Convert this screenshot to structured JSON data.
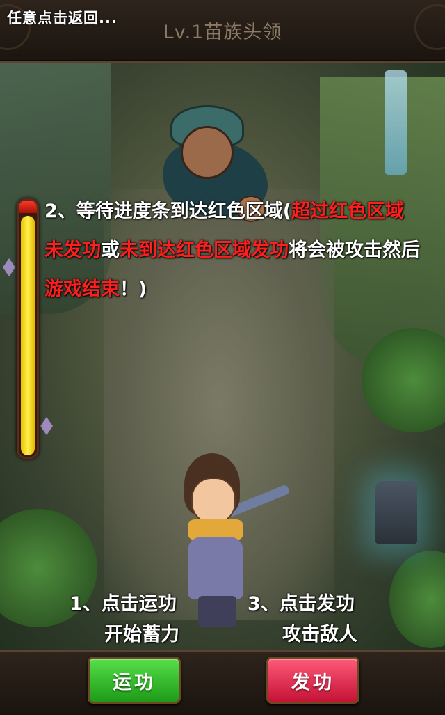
{
  "header": {
    "back_hint": "任意点击返回...",
    "level_title": "Lv.1苗族头领"
  },
  "instruction": {
    "parts": [
      {
        "text": "2、等待进度条到达红色区域(",
        "color": "white"
      },
      {
        "text": "超过红色区域未发功",
        "color": "red"
      },
      {
        "text": "或",
        "color": "white"
      },
      {
        "text": "未到达红色区域发功",
        "color": "red"
      },
      {
        "text": "将会被攻击然后",
        "color": "white"
      },
      {
        "text": "游戏结束",
        "color": "red"
      },
      {
        "text": "！)",
        "color": "white"
      }
    ]
  },
  "steps": {
    "step1": {
      "line1": "1、点击运功",
      "line2": "开始蓄力"
    },
    "step3": {
      "line1": "3、点击发功",
      "line2": "攻击敌人"
    }
  },
  "gauge": {
    "fill_fraction": 0.95,
    "fill_color": "#f2d600",
    "red_zone_color": "#e02010"
  },
  "buttons": {
    "charge_label": "运功",
    "release_label": "发功",
    "charge_color": "#2fbf28",
    "release_color": "#e02448"
  },
  "icons": {
    "enemy": "miao-chieftain-sprite",
    "hero": "swordsman-hero-sprite"
  }
}
